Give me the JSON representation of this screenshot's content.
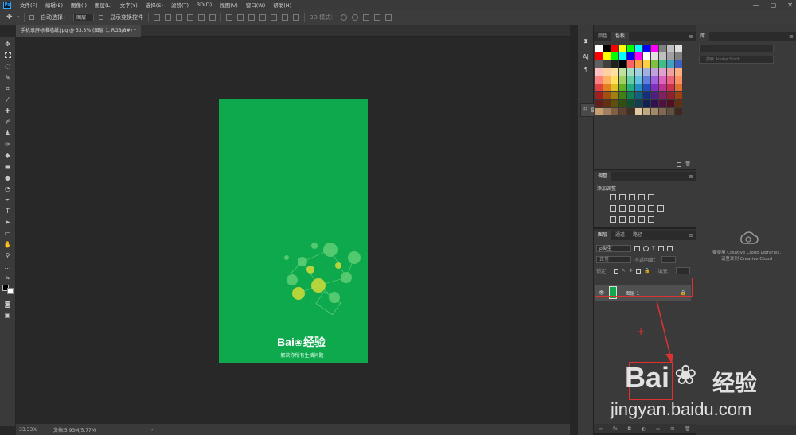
{
  "menubar": {
    "logo": "Ps",
    "items": [
      "文件(F)",
      "编辑(E)",
      "图像(I)",
      "图层(L)",
      "文字(Y)",
      "选择(S)",
      "滤镜(T)",
      "3D(D)",
      "视图(V)",
      "窗口(W)",
      "帮助(H)"
    ],
    "window_controls": [
      "—",
      "▢",
      "✕"
    ]
  },
  "options": {
    "auto_select_label": "自动选择：",
    "auto_select_value": "图层",
    "show_transform_label": "显示变换控件",
    "mode_3d_label": "3D 模式："
  },
  "document": {
    "tab_title": "手机录屏标准墙纸.jpg @ 33.3% (图层 1, RGB/8#) *",
    "brand_text": "Bai",
    "brand_cn": "经验",
    "slogan": "解决你所有生活问题"
  },
  "statusbar": {
    "zoom": "33.33%",
    "doc_info": "文档:5.93M/5.77M"
  },
  "props_flyout": {
    "label": "属性"
  },
  "colors_panel": {
    "tabs": [
      "颜色",
      "色板"
    ],
    "swatches": [
      "#ffffff",
      "#000000",
      "#ff0000",
      "#ffff00",
      "#00ff00",
      "#00ffff",
      "#0000ff",
      "#ff00ff",
      "#808080",
      "#c0c0c0",
      "#e0e0e0",
      "#ff0000",
      "#ffff00",
      "#00ff00",
      "#00ffff",
      "#0000ff",
      "#ff00ff",
      "#ffffff",
      "#e0e0e0",
      "#c0c0c0",
      "#a0a0a0",
      "#808080",
      "#606060",
      "#404040",
      "#202020",
      "#000000",
      "#ff6060",
      "#ffa040",
      "#ffd040",
      "#80c040",
      "#40c080",
      "#40a0c0",
      "#4060c0",
      "#ffc0c0",
      "#ffd0a0",
      "#ffe0a0",
      "#c0e0a0",
      "#a0e0c0",
      "#a0d0e0",
      "#a0b0e0",
      "#c0a0e0",
      "#e0a0d0",
      "#f0a0a0",
      "#ffb080",
      "#ff8080",
      "#ffb060",
      "#ffe060",
      "#a0d060",
      "#60d0a0",
      "#60c0e0",
      "#6080e0",
      "#a060e0",
      "#e060c0",
      "#f06080",
      "#ff9060",
      "#e04040",
      "#e08020",
      "#e0c020",
      "#60b020",
      "#20b080",
      "#2090c0",
      "#2050c0",
      "#8030c0",
      "#c03090",
      "#d03050",
      "#e07030",
      "#a02020",
      "#a05010",
      "#a08010",
      "#408010",
      "#108050",
      "#106080",
      "#103080",
      "#502080",
      "#802060",
      "#902030",
      "#a04010",
      "#602020",
      "#603010",
      "#605010",
      "#305010",
      "#105030",
      "#104050",
      "#102050",
      "#301050",
      "#501040",
      "#501020",
      "#603010",
      "#c8a070",
      "#a08060",
      "#806040",
      "#604030",
      "#403020",
      "#e0c8a0",
      "#c0a880",
      "#a08868",
      "#806850",
      "#605040",
      "#402820"
    ]
  },
  "adjust_panel": {
    "tab": "调整",
    "title": "添加调整"
  },
  "layers_panel": {
    "tabs": [
      "图层",
      "通道",
      "路径"
    ],
    "filter_label": "ρ类型",
    "blend_mode": "正常",
    "opacity_label": "不透明度：",
    "lock_label": "锁定：",
    "fill_label": "填充：",
    "layer_name": "图层 1"
  },
  "library_panel": {
    "tab": "库",
    "search_placeholder": "搜索 Adobe Stock",
    "message_line1": "要使用 Creative Cloud Libraries,",
    "message_line2": "请登录到 Creative Cloud"
  },
  "watermark": {
    "text": "Bai",
    "cn": "经验",
    "url": "jingyan.baidu.com"
  }
}
